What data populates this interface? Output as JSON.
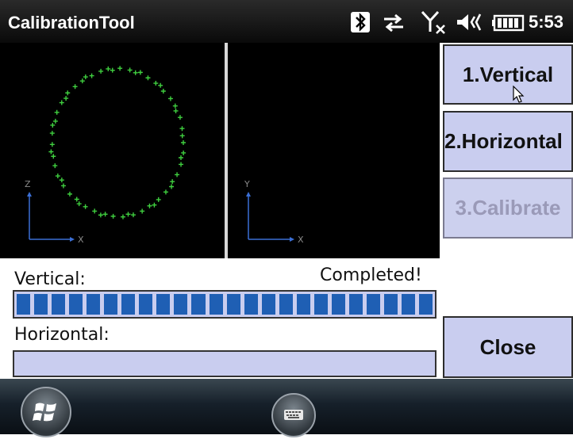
{
  "app": {
    "title": "CalibrationTool"
  },
  "status_bar": {
    "time": "5:53",
    "icons": [
      "bluetooth-icon",
      "sync-icon",
      "signal-off-icon",
      "volume-icon",
      "battery-icon"
    ]
  },
  "plots": {
    "vertical": {
      "axis_vertical": "Z",
      "axis_horizontal": "X"
    },
    "horizontal": {
      "axis_vertical": "Y",
      "axis_horizontal": "X"
    }
  },
  "buttons": {
    "vertical": "1.Vertical",
    "horizontal": "2.Horizontal",
    "calibrate": "3.Calibrate",
    "close": "Close"
  },
  "progress": {
    "vertical_label": "Vertical:",
    "vertical_status": "Completed!",
    "vertical_value": 1.0,
    "horizontal_label": "Horizontal:",
    "horizontal_value": 0.0
  },
  "colors": {
    "plot_points": "#3fcf3f",
    "axis": "#3b6fd6",
    "progress_fill": "#1f5fb4",
    "button_bg": "#c9cdef"
  },
  "taskbar": {
    "start_icon": "windows-logo-icon",
    "keyboard_icon": "keyboard-icon"
  }
}
